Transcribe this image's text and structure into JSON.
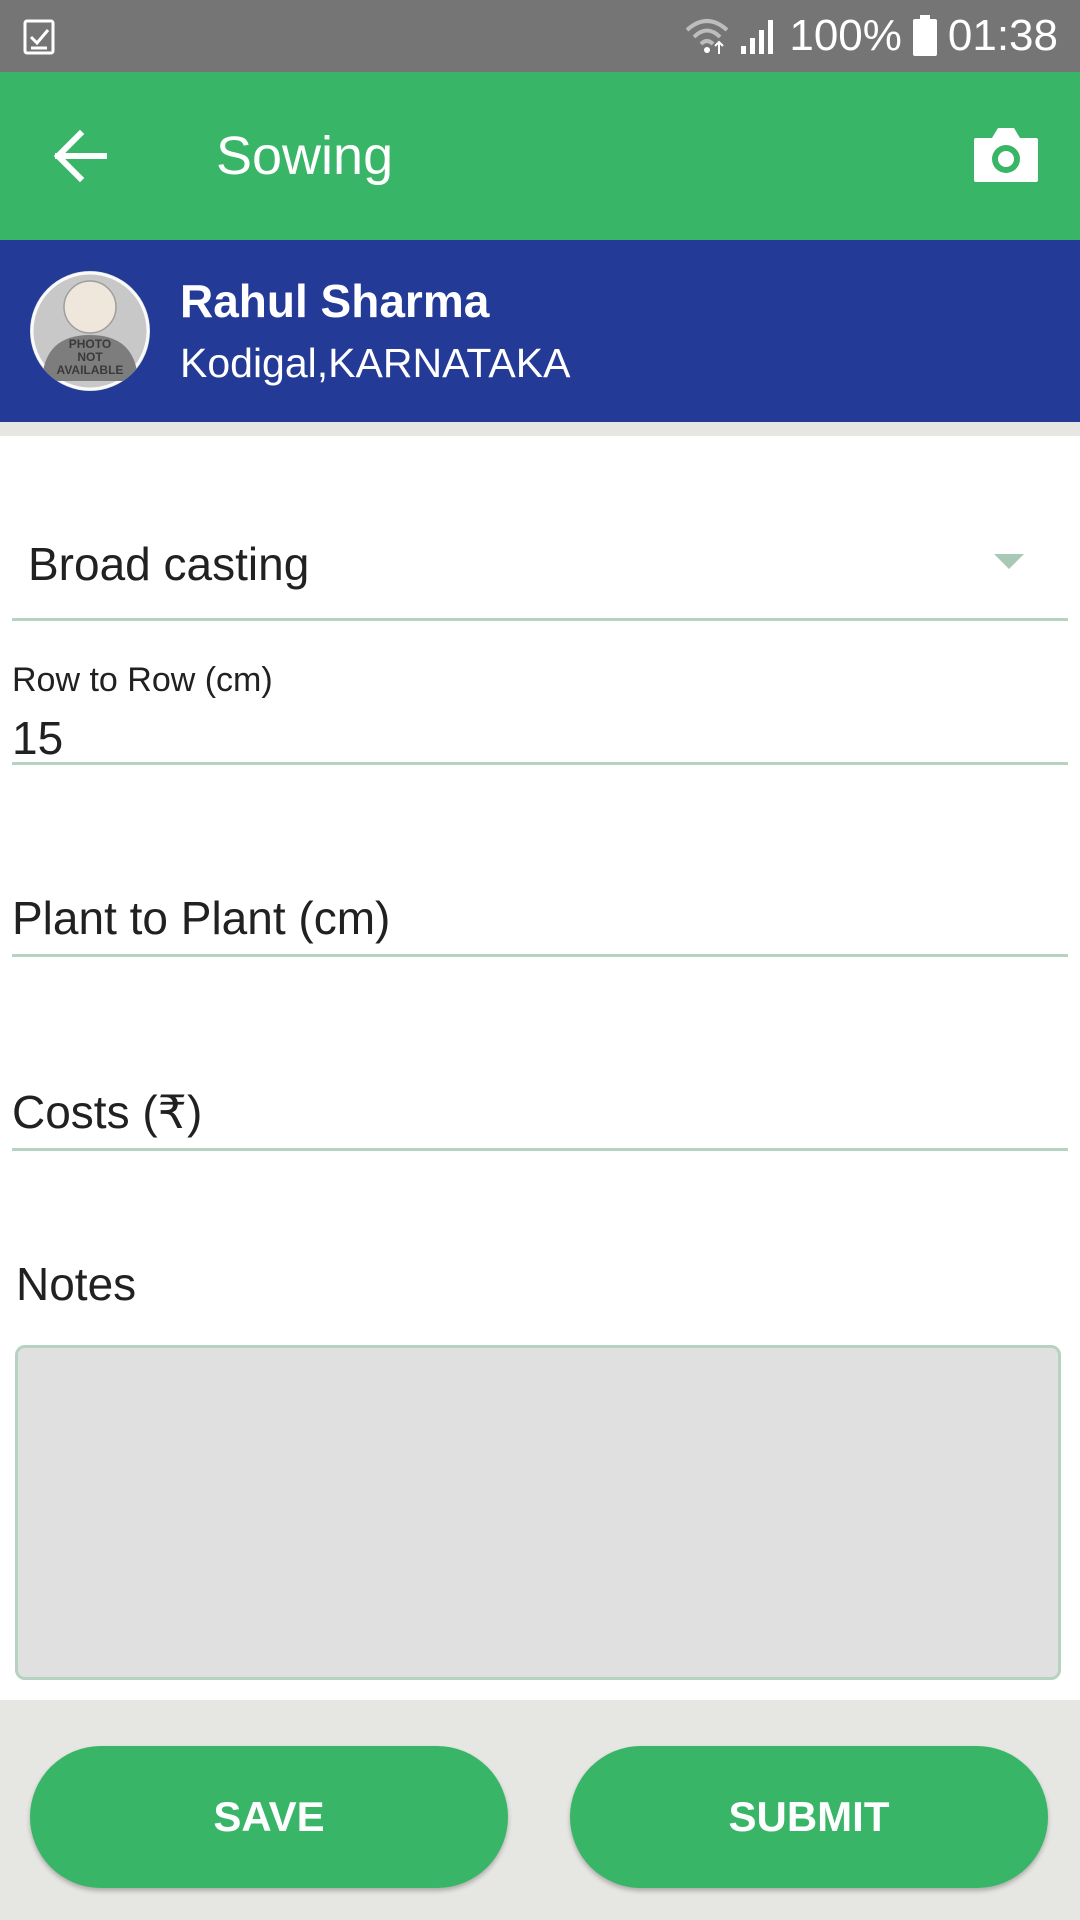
{
  "status_bar": {
    "battery": "100%",
    "time": "01:38",
    "icons": [
      "checklist-icon",
      "wifi-icon",
      "signal-icon",
      "battery-icon"
    ]
  },
  "app_bar": {
    "title": "Sowing",
    "back_icon": "arrow-back-icon",
    "camera_icon": "camera-icon",
    "color": "#38b566"
  },
  "profile": {
    "name": "Rahul Sharma",
    "location": "Kodigal,KARNATAKA",
    "avatar_text": [
      "PHOTO",
      "NOT",
      "AVAILABLE"
    ],
    "color": "#233a97"
  },
  "form": {
    "sowing_method": {
      "selected": "Broad casting"
    },
    "row_to_row": {
      "label": "Row to Row (cm)",
      "value": "15"
    },
    "plant_to_plant": {
      "placeholder": "Plant to Plant (cm)"
    },
    "costs": {
      "placeholder": "Costs (₹)"
    },
    "notes": {
      "label": "Notes",
      "value": ""
    }
  },
  "actions": {
    "save_label": "SAVE",
    "submit_label": "SUBMIT"
  }
}
